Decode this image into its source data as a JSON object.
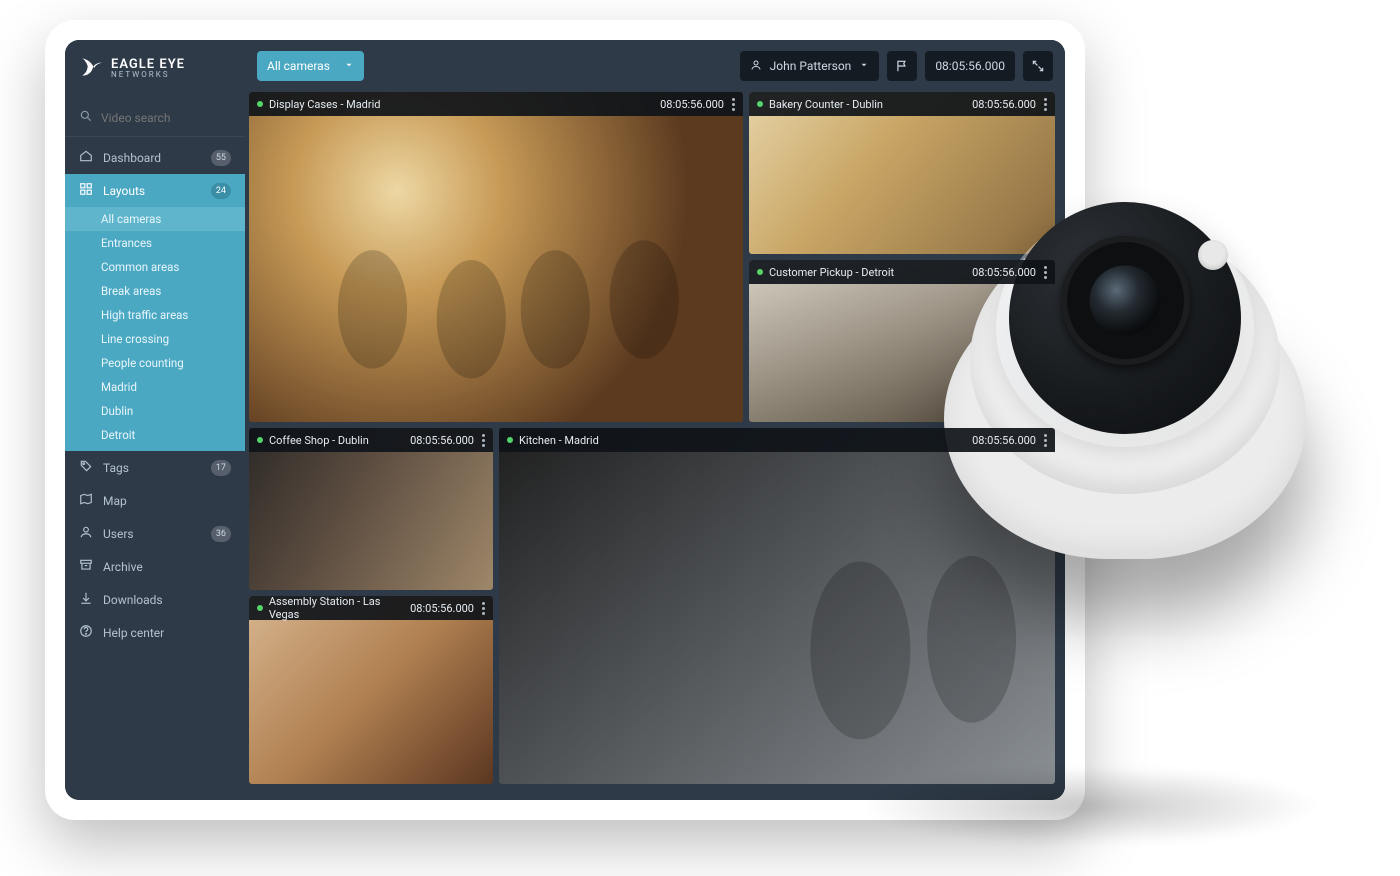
{
  "brand": {
    "line1": "EAGLE EYE",
    "line2": "NETWORKS"
  },
  "search": {
    "placeholder": "Video search"
  },
  "nav": {
    "dashboard": {
      "label": "Dashboard",
      "badge": "55"
    },
    "layouts": {
      "label": "Layouts",
      "badge": "24"
    },
    "tags": {
      "label": "Tags",
      "badge": "17"
    },
    "map": {
      "label": "Map"
    },
    "users": {
      "label": "Users",
      "badge": "36"
    },
    "archive": {
      "label": "Archive"
    },
    "downloads": {
      "label": "Downloads"
    },
    "help": {
      "label": "Help center"
    }
  },
  "layouts_sub": [
    "All cameras",
    "Entrances",
    "Common areas",
    "Break areas",
    "High traffic areas",
    "Line crossing",
    "People counting",
    "Madrid",
    "Dublin",
    "Detroit"
  ],
  "topbar": {
    "dropdown_label": "All cameras",
    "user": "John Patterson",
    "time": "08:05:56.000"
  },
  "tiles": {
    "t1": {
      "name": "Display Cases - Madrid",
      "time": "08:05:56.000"
    },
    "t2": {
      "name": "Bakery Counter - Dublin",
      "time": "08:05:56.000"
    },
    "t3": {
      "name": "Customer Pickup - Detroit",
      "time": "08:05:56.000"
    },
    "t4": {
      "name": "Coffee Shop - Dublin",
      "time": "08:05:56.000"
    },
    "t5": {
      "name": "Kitchen - Madrid",
      "time": "08:05:56.000"
    },
    "t6": {
      "name": "Assembly Station - Las Vegas",
      "time": "08:05:56.000"
    }
  }
}
